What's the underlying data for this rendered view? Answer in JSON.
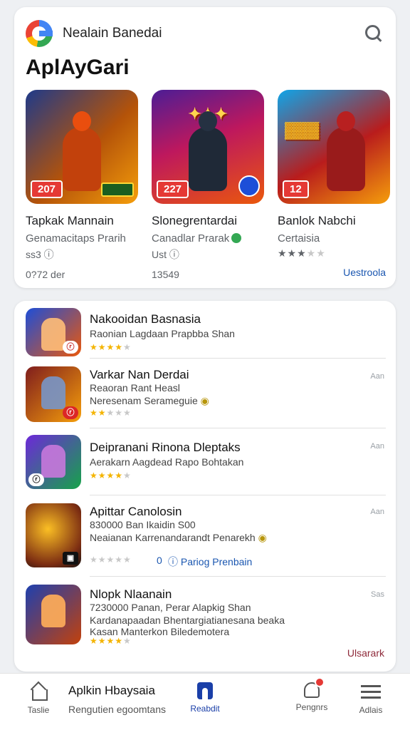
{
  "header": {
    "title": "Nealain Banedai"
  },
  "section": {
    "title": "AplAyGari"
  },
  "featured": [
    {
      "name": "Tapkak Mannain",
      "subtitle": "Genamacitaps Prarih",
      "meta": "ss3 ⓘ",
      "downloads": "0?72 der",
      "badge": "207",
      "stars": ""
    },
    {
      "name": "Slonegrentardai",
      "subtitle": "Canadlar Prarak",
      "meta": "Ust ⓘ",
      "downloads": "13549",
      "badge": "227",
      "stars": ""
    },
    {
      "name": "Banlok Nabchi",
      "subtitle": "Certaisia",
      "meta": "",
      "downloads": "",
      "badge": "12",
      "stars": "★★★★★"
    }
  ],
  "featured_link": "Uestroola",
  "list": [
    {
      "title": "Nakooidan Basnasia",
      "desc1": "Raonian Lagdaan Prapbba Shan",
      "desc2": "",
      "rating": 4,
      "ad": ""
    },
    {
      "title": "Varkar Nan Derdai",
      "desc1": "Reaoran Rant Heasl",
      "desc2": "Neresenam Serameguie",
      "rating": 2,
      "ad": "Aan"
    },
    {
      "title": "Deipranani Rinona Dleptaks",
      "desc1": "Aerakarn Aagdead Rapo Bohtakan",
      "desc2": "",
      "rating": 4,
      "ad": "Aan"
    },
    {
      "title": "Apittar Canolosin",
      "desc1": "830000 Ban Ikaidin S00",
      "desc2": "Neaianan Karrenandarandt Penarekh",
      "rating": 0,
      "ad": "Aan",
      "link": "Pariog Prenbain",
      "count": "0"
    },
    {
      "title": "Nlopk Nlaanain",
      "desc1": "7230000 Panan, Perar Alapkig Shan",
      "desc2": "Kardanapaadan Bhentargiatianesana beaka",
      "desc3": "Kasan Manterkon Biledemotera",
      "rating": 4,
      "ad": "Sas"
    }
  ],
  "list_link": "Ulsarark",
  "nav": {
    "home": "Taslie",
    "mid_title": "Aplkin Hbaysaia",
    "mid_sub": "Rengutien egoomtans",
    "apps": "Reabdit",
    "notif": "Pengnrs",
    "menu": "Adlais"
  },
  "colors": {
    "accent": "#1a3fa8",
    "star": "#f4b400",
    "badge": "#e53935"
  }
}
